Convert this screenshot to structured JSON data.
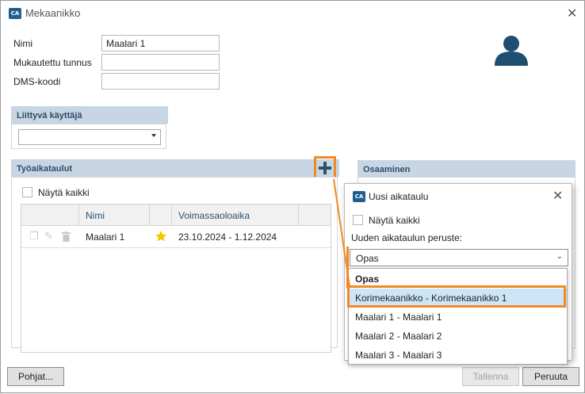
{
  "window": {
    "title": "Mekaanikko"
  },
  "app_icon_text": "CA",
  "form": {
    "name_label": "Nimi",
    "name_value": "Maalari 1",
    "custom_id_label": "Mukautettu tunnus",
    "custom_id_value": "",
    "dms_label": "DMS-koodi",
    "dms_value": ""
  },
  "linked_user": {
    "header": "Liittyvä käyttäjä",
    "selected": ""
  },
  "schedules": {
    "header": "Työaikataulut",
    "show_all_label": "Näytä kaikki",
    "columns": [
      "Nimi",
      "Voimassaoloaika"
    ],
    "rows": [
      {
        "name": "Maalari 1",
        "validity": "23.10.2024 - 1.12.2024",
        "starred": true
      }
    ]
  },
  "skills": {
    "header": "Osaaminen"
  },
  "buttons": {
    "templates": "Pohjat...",
    "save": "Tallenna",
    "cancel": "Peruuta"
  },
  "popup": {
    "title": "Uusi aikataulu",
    "show_all_label": "Näytä kaikki",
    "basis_label": "Uuden aikataulun peruste:",
    "basis_selected": "Opas",
    "options": [
      {
        "label": "Opas",
        "bold": true
      },
      {
        "label": "Korimekaanikko - Korimekaanikko 1",
        "selected": true
      },
      {
        "label": "Maalari 1 - Maalari 1"
      },
      {
        "label": "Maalari 2 - Maalari 2"
      },
      {
        "label": "Maalari 3 - Maalari 3"
      }
    ]
  },
  "colors": {
    "header_bg": "#c7d6e2",
    "header_text": "#2d4f6c",
    "highlight": "#f08a24",
    "selected_option_bg": "#cde6f7",
    "star": "#f7c600",
    "avatar": "#1f4f70"
  },
  "icons": [
    "app-logo-icon",
    "close-icon",
    "user-avatar-icon",
    "add-icon",
    "copy-icon",
    "edit-icon",
    "delete-icon",
    "star-icon",
    "dropdown-caret-icon"
  ]
}
